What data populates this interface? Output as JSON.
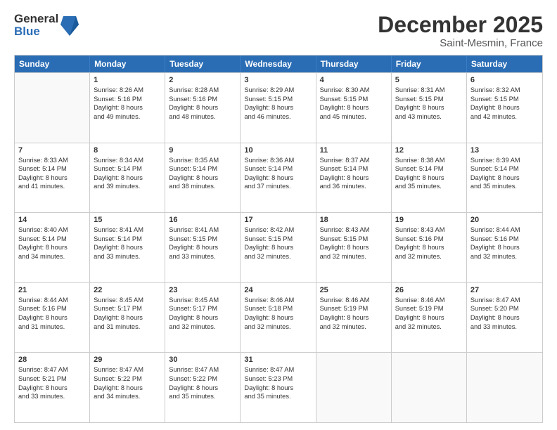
{
  "logo": {
    "text_general": "General",
    "text_blue": "Blue"
  },
  "header": {
    "title": "December 2025",
    "subtitle": "Saint-Mesmin, France"
  },
  "calendar": {
    "days_of_week": [
      "Sunday",
      "Monday",
      "Tuesday",
      "Wednesday",
      "Thursday",
      "Friday",
      "Saturday"
    ],
    "weeks": [
      [
        {
          "day": "",
          "empty": true
        },
        {
          "day": "1",
          "sunrise": "8:26 AM",
          "sunset": "5:16 PM",
          "daylight": "8 hours and 49 minutes."
        },
        {
          "day": "2",
          "sunrise": "8:28 AM",
          "sunset": "5:16 PM",
          "daylight": "8 hours and 48 minutes."
        },
        {
          "day": "3",
          "sunrise": "8:29 AM",
          "sunset": "5:15 PM",
          "daylight": "8 hours and 46 minutes."
        },
        {
          "day": "4",
          "sunrise": "8:30 AM",
          "sunset": "5:15 PM",
          "daylight": "8 hours and 45 minutes."
        },
        {
          "day": "5",
          "sunrise": "8:31 AM",
          "sunset": "5:15 PM",
          "daylight": "8 hours and 43 minutes."
        },
        {
          "day": "6",
          "sunrise": "8:32 AM",
          "sunset": "5:15 PM",
          "daylight": "8 hours and 42 minutes."
        }
      ],
      [
        {
          "day": "7",
          "sunrise": "8:33 AM",
          "sunset": "5:14 PM",
          "daylight": "8 hours and 41 minutes."
        },
        {
          "day": "8",
          "sunrise": "8:34 AM",
          "sunset": "5:14 PM",
          "daylight": "8 hours and 39 minutes."
        },
        {
          "day": "9",
          "sunrise": "8:35 AM",
          "sunset": "5:14 PM",
          "daylight": "8 hours and 38 minutes."
        },
        {
          "day": "10",
          "sunrise": "8:36 AM",
          "sunset": "5:14 PM",
          "daylight": "8 hours and 37 minutes."
        },
        {
          "day": "11",
          "sunrise": "8:37 AM",
          "sunset": "5:14 PM",
          "daylight": "8 hours and 36 minutes."
        },
        {
          "day": "12",
          "sunrise": "8:38 AM",
          "sunset": "5:14 PM",
          "daylight": "8 hours and 35 minutes."
        },
        {
          "day": "13",
          "sunrise": "8:39 AM",
          "sunset": "5:14 PM",
          "daylight": "8 hours and 35 minutes."
        }
      ],
      [
        {
          "day": "14",
          "sunrise": "8:40 AM",
          "sunset": "5:14 PM",
          "daylight": "8 hours and 34 minutes."
        },
        {
          "day": "15",
          "sunrise": "8:41 AM",
          "sunset": "5:14 PM",
          "daylight": "8 hours and 33 minutes."
        },
        {
          "day": "16",
          "sunrise": "8:41 AM",
          "sunset": "5:15 PM",
          "daylight": "8 hours and 33 minutes."
        },
        {
          "day": "17",
          "sunrise": "8:42 AM",
          "sunset": "5:15 PM",
          "daylight": "8 hours and 32 minutes."
        },
        {
          "day": "18",
          "sunrise": "8:43 AM",
          "sunset": "5:15 PM",
          "daylight": "8 hours and 32 minutes."
        },
        {
          "day": "19",
          "sunrise": "8:43 AM",
          "sunset": "5:16 PM",
          "daylight": "8 hours and 32 minutes."
        },
        {
          "day": "20",
          "sunrise": "8:44 AM",
          "sunset": "5:16 PM",
          "daylight": "8 hours and 32 minutes."
        }
      ],
      [
        {
          "day": "21",
          "sunrise": "8:44 AM",
          "sunset": "5:16 PM",
          "daylight": "8 hours and 31 minutes."
        },
        {
          "day": "22",
          "sunrise": "8:45 AM",
          "sunset": "5:17 PM",
          "daylight": "8 hours and 31 minutes."
        },
        {
          "day": "23",
          "sunrise": "8:45 AM",
          "sunset": "5:17 PM",
          "daylight": "8 hours and 32 minutes."
        },
        {
          "day": "24",
          "sunrise": "8:46 AM",
          "sunset": "5:18 PM",
          "daylight": "8 hours and 32 minutes."
        },
        {
          "day": "25",
          "sunrise": "8:46 AM",
          "sunset": "5:19 PM",
          "daylight": "8 hours and 32 minutes."
        },
        {
          "day": "26",
          "sunrise": "8:46 AM",
          "sunset": "5:19 PM",
          "daylight": "8 hours and 32 minutes."
        },
        {
          "day": "27",
          "sunrise": "8:47 AM",
          "sunset": "5:20 PM",
          "daylight": "8 hours and 33 minutes."
        }
      ],
      [
        {
          "day": "28",
          "sunrise": "8:47 AM",
          "sunset": "5:21 PM",
          "daylight": "8 hours and 33 minutes."
        },
        {
          "day": "29",
          "sunrise": "8:47 AM",
          "sunset": "5:22 PM",
          "daylight": "8 hours and 34 minutes."
        },
        {
          "day": "30",
          "sunrise": "8:47 AM",
          "sunset": "5:22 PM",
          "daylight": "8 hours and 35 minutes."
        },
        {
          "day": "31",
          "sunrise": "8:47 AM",
          "sunset": "5:23 PM",
          "daylight": "8 hours and 35 minutes."
        },
        {
          "day": "",
          "empty": true
        },
        {
          "day": "",
          "empty": true
        },
        {
          "day": "",
          "empty": true
        }
      ]
    ]
  }
}
